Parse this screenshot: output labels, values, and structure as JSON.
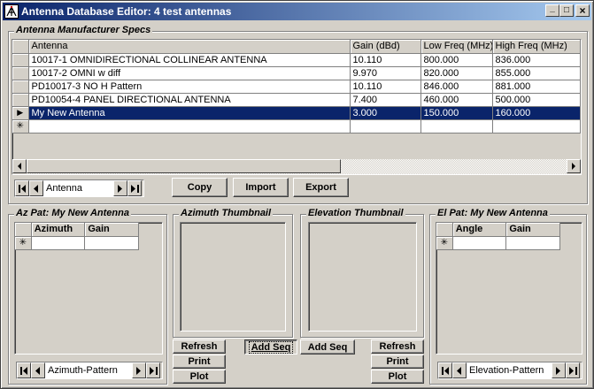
{
  "window": {
    "title": "Antenna Database Editor: 4 test antennas",
    "min": "_",
    "max": "□",
    "close": "×"
  },
  "specs": {
    "legend": "Antenna Manufacturer Specs",
    "columns": [
      "Antenna",
      "Gain (dBd)",
      "Low Freq (MHz)",
      "High Freq (MHz)"
    ],
    "rows": [
      {
        "marker": "",
        "antenna": "10017-1 OMNIDIRECTIONAL COLLINEAR ANTENNA",
        "gain": "10.110",
        "low": "800.000",
        "high": "836.000"
      },
      {
        "marker": "",
        "antenna": "10017-2 OMNI w diff",
        "gain": "9.970",
        "low": "820.000",
        "high": "855.000"
      },
      {
        "marker": "",
        "antenna": "PD10017-3 NO H Pattern",
        "gain": "10.110",
        "low": "846.000",
        "high": "881.000"
      },
      {
        "marker": "",
        "antenna": "PD10054-4 PANEL DIRECTIONAL ANTENNA",
        "gain": "7.400",
        "low": "460.000",
        "high": "500.000"
      },
      {
        "marker": "▶",
        "antenna": "My New Antenna",
        "gain": "3.000",
        "low": "150.000",
        "high": "160.000",
        "selected": true
      },
      {
        "marker": "✳",
        "antenna": "",
        "gain": "",
        "low": "",
        "high": ""
      }
    ],
    "nav_label": "Antenna",
    "buttons": {
      "copy": "Copy",
      "import": "Import",
      "export": "Export"
    }
  },
  "az": {
    "legend": "Az Pat: My New Antenna",
    "columns": [
      "Azimuth",
      "Gain"
    ],
    "new_marker": "✳",
    "nav_label": "Azimuth-Pattern"
  },
  "az_thumb": {
    "legend": "Azimuth Thumbnail"
  },
  "el_thumb": {
    "legend": "Elevation Thumbnail"
  },
  "el": {
    "legend": "El Pat: My New Antenna",
    "columns": [
      "Angle",
      "Gain"
    ],
    "new_marker": "✳",
    "nav_label": "Elevation-Pattern"
  },
  "az_buttons": {
    "refresh": "Refresh",
    "print": "Print",
    "plot": "Plot"
  },
  "el_buttons": {
    "refresh": "Refresh",
    "print": "Print",
    "plot": "Plot"
  },
  "seq_buttons": {
    "add_seq_1": "Add Seq",
    "add_seq_2": "Add Seq"
  }
}
